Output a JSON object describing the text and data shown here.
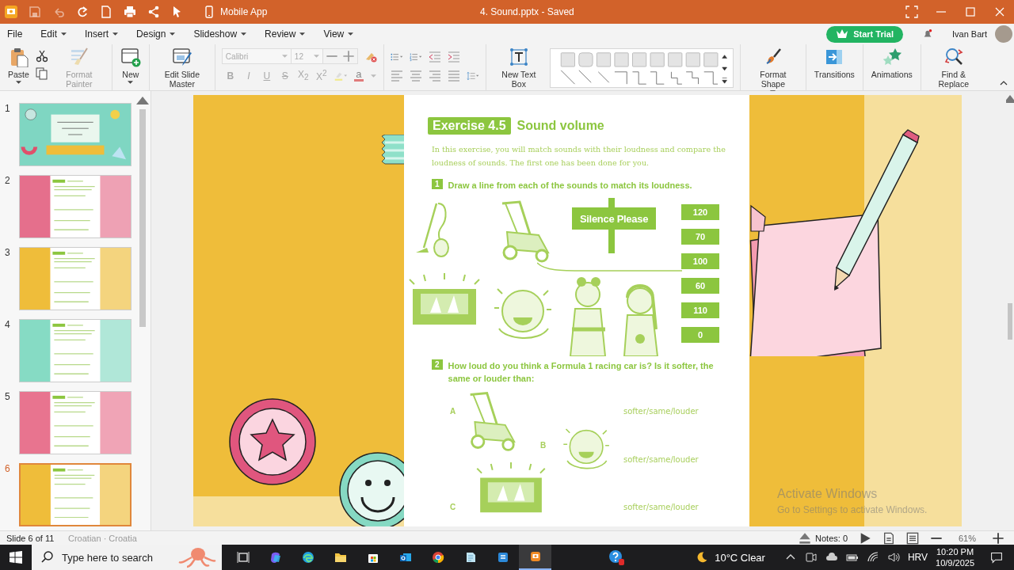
{
  "title_bar": {
    "mobile_app": "Mobile App",
    "title": "4. Sound.pptx - Saved",
    "save_disabled": true
  },
  "menu": [
    {
      "label": "File",
      "dropdown": false
    },
    {
      "label": "Edit",
      "dropdown": true
    },
    {
      "label": "Insert",
      "dropdown": true
    },
    {
      "label": "Design",
      "dropdown": true
    },
    {
      "label": "Slideshow",
      "dropdown": true
    },
    {
      "label": "Review",
      "dropdown": true
    },
    {
      "label": "View",
      "dropdown": true
    }
  ],
  "account": {
    "start_trial": "Start Trial",
    "user_name": "Ivan Bart"
  },
  "ribbon_groups": [
    [
      {
        "kind": "paste",
        "label": "Paste",
        "dropdown": true,
        "disabled": false
      },
      {
        "kind": "cut-copy"
      },
      {
        "kind": "format-painter",
        "label": "Format Painter",
        "dropdown": false,
        "disabled": true
      }
    ],
    [
      {
        "kind": "new-slide",
        "label": "New",
        "dropdown": true,
        "disabled": false
      }
    ],
    [
      {
        "kind": "slide-master",
        "label": "Edit Slide Master",
        "dropdown": false,
        "disabled": false
      }
    ],
    [
      {
        "kind": "font",
        "font_name": "Calibri",
        "font_size": "12",
        "format_buttons": [
          "B",
          "I",
          "U",
          "S",
          "X$_{2}$",
          "X$^{2}$"
        ],
        "font_color_glyph": "a",
        "disabled": true
      }
    ],
    [
      {
        "kind": "paragraph"
      }
    ],
    [
      {
        "kind": "text-box",
        "label": "New Text Box",
        "dropdown": false,
        "disabled": false
      },
      {
        "kind": "shape-gallery"
      }
    ],
    [
      {
        "kind": "format-shape",
        "label": "Format Shape",
        "dropdown": true,
        "disabled": false
      }
    ],
    [
      {
        "kind": "transitions",
        "label": "Transitions",
        "dropdown": false,
        "disabled": false
      }
    ],
    [
      {
        "kind": "animations",
        "label": "Animations",
        "dropdown": false,
        "disabled": false
      }
    ],
    [
      {
        "kind": "find-replace",
        "label": "Find & Replace",
        "dropdown": false,
        "disabled": false
      }
    ]
  ],
  "slides": [
    {
      "number": "1",
      "kind": "title",
      "color": "#7fd6c2",
      "selected": false
    },
    {
      "number": "2",
      "kind": "page",
      "color": "#e56f8c",
      "selected": false
    },
    {
      "number": "3",
      "kind": "page",
      "color": "#efbd3a",
      "selected": false
    },
    {
      "number": "4",
      "kind": "page",
      "color": "#86dbc4",
      "selected": false
    },
    {
      "number": "5",
      "kind": "page",
      "color": "#e8748f",
      "selected": false
    },
    {
      "number": "6",
      "kind": "page",
      "color": "#efbd3a",
      "selected": true
    }
  ],
  "slide": {
    "exercise_badge": "Exercise 4.5",
    "exercise_title": "Sound volume",
    "intro": "In this exercise, you will match sounds with their loudness and compare the loudness of sounds. The first one has been done for you.",
    "questions": [
      {
        "number": "1",
        "text": "Draw a line from each of the sounds to match its loudness."
      },
      {
        "number": "2",
        "text": "How loud do you think a Formula 1 racing car is? Is it softer, the same or louder than:"
      }
    ],
    "sign": "Silence Please",
    "loudness_values": [
      "120",
      "70",
      "100",
      "60",
      "110",
      "0"
    ],
    "options": [
      {
        "letter": "A",
        "answer": "softer/same/louder"
      },
      {
        "letter": "B",
        "answer": "softer/same/louder"
      },
      {
        "letter": "C",
        "answer": "softer/same/louder"
      }
    ]
  },
  "overlay": {
    "heading": "Activate Windows",
    "text": "Go to Settings to activate Windows."
  },
  "status_bar": {
    "slide_info": "Slide 6 of 11",
    "language": "Croatian · Croatia",
    "notes": "Notes: 0",
    "zoom": "61%"
  },
  "taskbar": {
    "search_placeholder": "Type here to search",
    "weather": "10°C  Clear",
    "language": "HRV",
    "time": "10:20 PM",
    "date": "10/9/2025"
  }
}
